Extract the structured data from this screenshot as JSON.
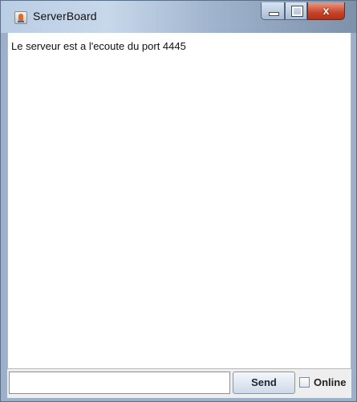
{
  "window": {
    "title": "ServerBoard",
    "close_glyph": "x"
  },
  "log": {
    "lines": [
      "Le serveur est a l'ecoute du port 4445"
    ]
  },
  "input": {
    "value": ""
  },
  "controls": {
    "send_label": "Send",
    "online_label": "Online",
    "online_checked": false
  },
  "icons": {
    "app": "java-cup-icon",
    "minimize": "minimize-icon",
    "maximize": "maximize-icon",
    "close": "close-icon"
  },
  "colors": {
    "close_button": "#c7442a",
    "title_bar": "#b9cde4"
  }
}
